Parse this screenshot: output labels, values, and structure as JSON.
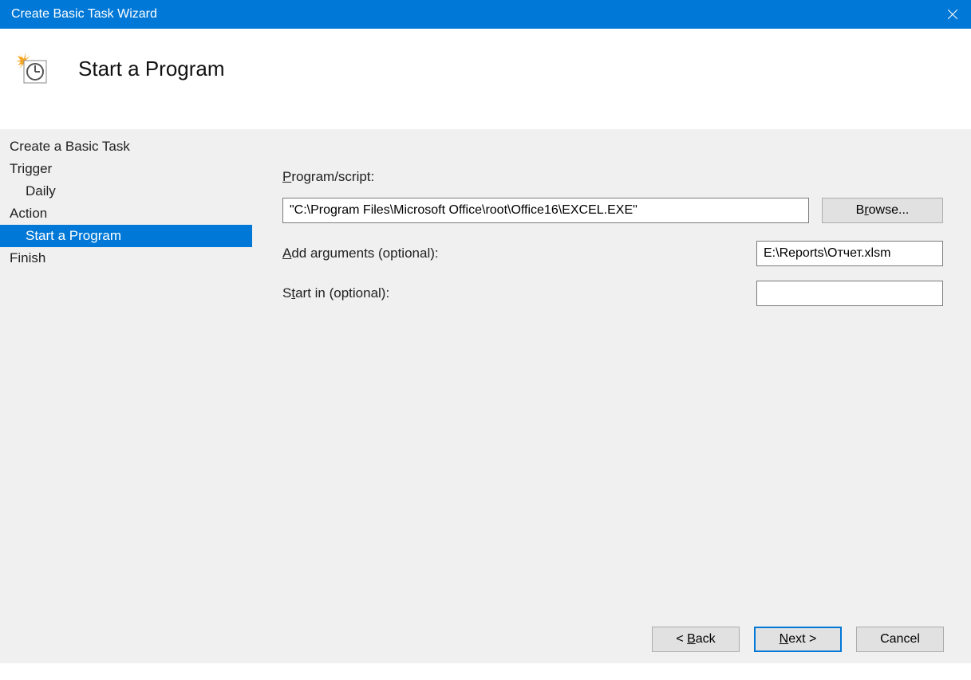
{
  "titlebar": {
    "title": "Create Basic Task Wizard"
  },
  "header": {
    "title": "Start a Program"
  },
  "sidebar": {
    "items": [
      {
        "label": "Create a Basic Task",
        "indent": false,
        "selected": false
      },
      {
        "label": "Trigger",
        "indent": false,
        "selected": false
      },
      {
        "label": "Daily",
        "indent": true,
        "selected": false
      },
      {
        "label": "Action",
        "indent": false,
        "selected": false
      },
      {
        "label": "Start a Program",
        "indent": true,
        "selected": true
      },
      {
        "label": "Finish",
        "indent": false,
        "selected": false
      }
    ]
  },
  "form": {
    "program_label_pre": "P",
    "program_label_post": "rogram/script:",
    "program_value": "\"C:\\Program Files\\Microsoft Office\\root\\Office16\\EXCEL.EXE\"",
    "browse_pre": "B",
    "browse_u": "r",
    "browse_post": "owse...",
    "args_label_pre": "A",
    "args_label_post": "dd arguments (optional):",
    "args_value": "E:\\Reports\\Отчет.xlsm",
    "startin_pre": "S",
    "startin_u": "t",
    "startin_post": "art in (optional):",
    "startin_value": ""
  },
  "footer": {
    "back_pre": "< ",
    "back_u": "B",
    "back_post": "ack",
    "next_u": "N",
    "next_post": "ext >",
    "cancel": "Cancel"
  }
}
